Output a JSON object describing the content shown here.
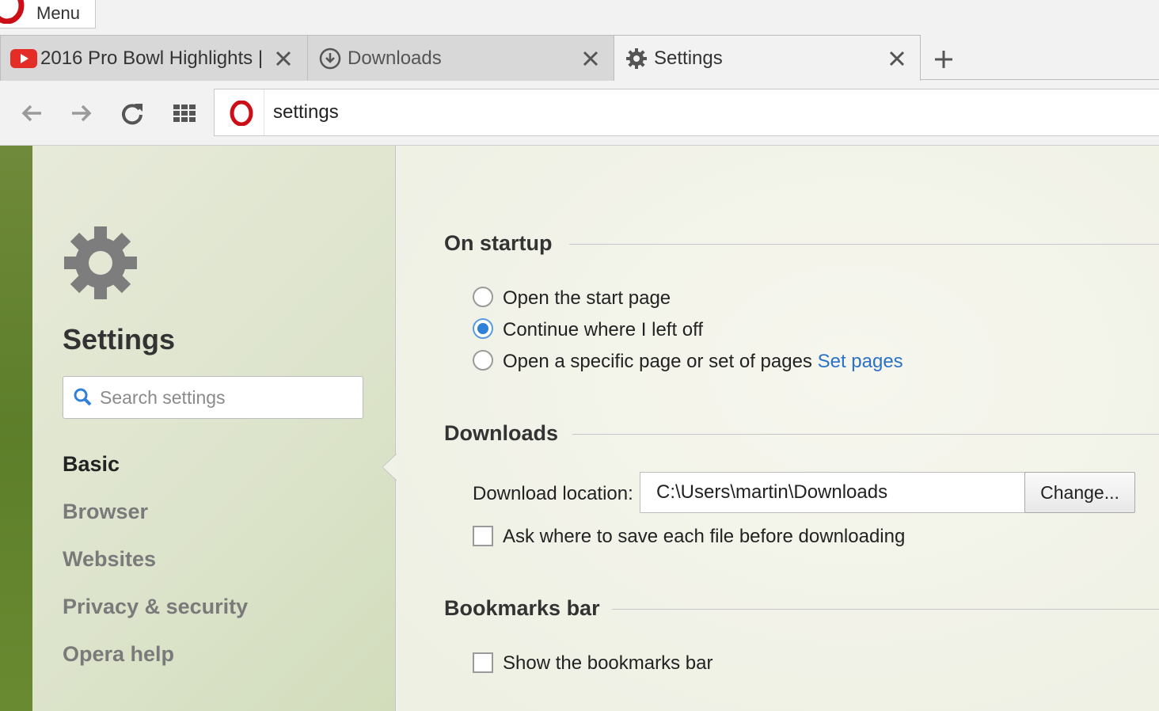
{
  "menu": {
    "label": "Menu"
  },
  "tabs": [
    {
      "title": "2016 Pro Bowl Highlights |",
      "icon": "youtube-icon"
    },
    {
      "title": "Downloads",
      "icon": "download-icon"
    },
    {
      "title": "Settings",
      "icon": "gear-icon"
    }
  ],
  "toolbar": {
    "address": "settings"
  },
  "sidebar": {
    "title": "Settings",
    "search_placeholder": "Search settings",
    "items": [
      {
        "label": "Basic"
      },
      {
        "label": "Browser"
      },
      {
        "label": "Websites"
      },
      {
        "label": "Privacy & security"
      },
      {
        "label": "Opera help"
      }
    ]
  },
  "main": {
    "startup": {
      "title": "On startup",
      "options": [
        {
          "label": "Open the start page",
          "checked": false
        },
        {
          "label": "Continue where I left off",
          "checked": true
        },
        {
          "label": "Open a specific page or set of pages",
          "checked": false
        }
      ],
      "set_pages_link": "Set pages"
    },
    "downloads": {
      "title": "Downloads",
      "location_label": "Download location:",
      "location_value": "C:\\Users\\martin\\Downloads",
      "change_button": "Change...",
      "ask_label": "Ask where to save each file before downloading",
      "ask_checked": false
    },
    "bookmarks": {
      "title": "Bookmarks bar",
      "show_label": "Show the bookmarks bar",
      "show_checked": false
    }
  },
  "colors": {
    "accent": "#2f80d6",
    "opera_red": "#cc0f16",
    "link": "#2a72c7"
  }
}
